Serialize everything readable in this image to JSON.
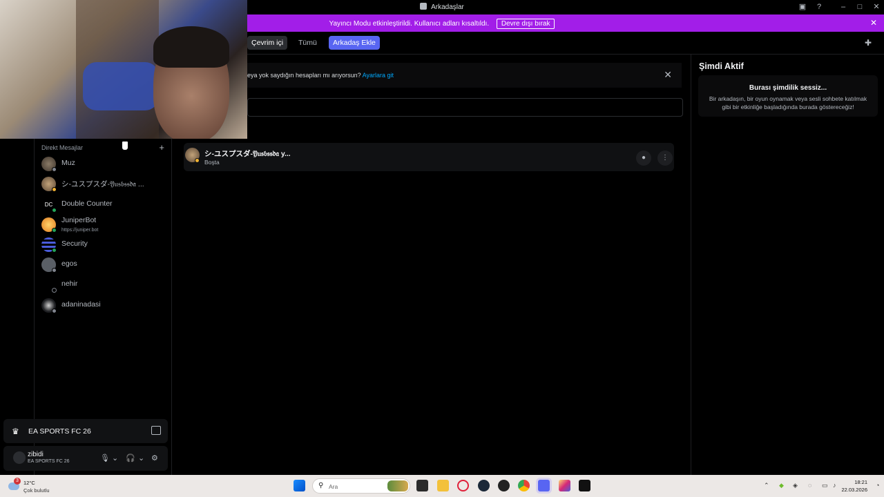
{
  "window": {
    "title": "Arkadaşlar",
    "controls": [
      "inbox-icon",
      "help-icon",
      "minimize-icon",
      "maximize-icon",
      "close-icon"
    ]
  },
  "banner": {
    "message": "Yayıncı Modu etkinleştirildi. Kullanıcı adları kısaltıldı.",
    "button": "Devre dışı bırak",
    "color": "#a21ee8"
  },
  "tabs": [
    {
      "label": "Çevrim içi",
      "state": "active"
    },
    {
      "label": "Tümü",
      "state": "normal"
    },
    {
      "label": "Arkadaş Ekle",
      "state": "primary"
    }
  ],
  "notice": {
    "text": "eya yok saydığın hesapları mı arıyorsun?",
    "link": "Ayarlara git"
  },
  "sidebar": {
    "dm_header": "Direkt Mesajlar",
    "items": [
      {
        "name": "Muz",
        "sub": "",
        "avatar_color": "#7a6a55"
      },
      {
        "name": "シ-ユスプスダ-𝔜𝔲𝔰𝔟𝔰𝔰𝔡𝔞 ...",
        "sub": "",
        "avatar_color": "#8a7055"
      },
      {
        "name": "Double Counter",
        "sub": "",
        "avatar_color": "#111111"
      },
      {
        "name": "JuniperBot",
        "sub": "https://juniper.bot",
        "avatar_color": "#f0a030"
      },
      {
        "name": "Security",
        "sub": "",
        "avatar_color": "#3b4bbd"
      },
      {
        "name": "egos",
        "sub": "",
        "avatar_color": "#5a5f66"
      },
      {
        "name": "nehir",
        "sub": "",
        "avatar_color": "#000000"
      },
      {
        "name": "adaninadasi",
        "sub": "",
        "avatar_color": "#2b2d31"
      }
    ]
  },
  "game_panel": {
    "name": "EA SPORTS FC 26"
  },
  "user_panel": {
    "name": "zibidi",
    "status": "EA SPORTS FC 26"
  },
  "friend": {
    "name": "シ-ユスプスダ-𝔜𝔲𝔰𝔟𝔰𝔰𝔡𝔞 y...",
    "status": "Boşta"
  },
  "activity": {
    "title": "Şimdi Aktif",
    "empty_title": "Burası şimdilik sessiz...",
    "empty_desc": "Bir arkadaşın, bir oyun oynamak veya sesli sohbete katılmak gibi bir etkinliğe başladığında burada göstereceğiz!"
  },
  "taskbar": {
    "weather_badge": "3",
    "temp": "12°C",
    "condition": "Çok bulutlu",
    "search_placeholder": "Ara",
    "time": "18:21",
    "date": "22.03.2026",
    "apps": [
      "windows-start-icon",
      "task-view-icon",
      "file-explorer-icon",
      "opera-icon",
      "steam-icon",
      "xbox-icon",
      "chrome-icon",
      "discord-icon",
      "instagram-icon",
      "ea-icon"
    ]
  },
  "colors": {
    "accent": "#5865f2",
    "idle": "#f0b232",
    "link": "#00a8fc"
  }
}
